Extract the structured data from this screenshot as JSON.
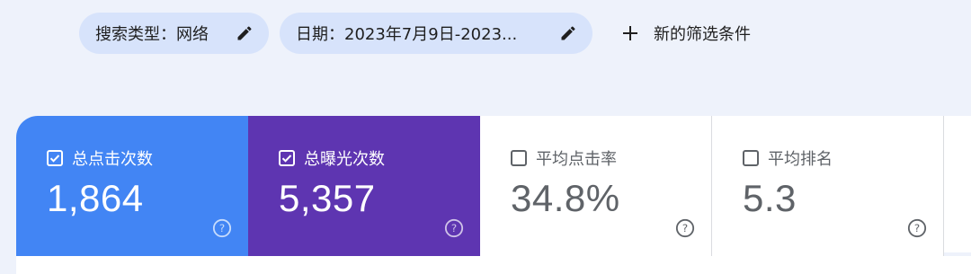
{
  "filters": {
    "search_type_chip": "搜索类型：网络",
    "date_chip": "日期：2023年7月9日-2023...",
    "new_filter_label": "新的筛选条件"
  },
  "metrics": [
    {
      "label": "总点击次数",
      "value": "1,864",
      "checked": true,
      "color": "#4285f4"
    },
    {
      "label": "总曝光次数",
      "value": "5,357",
      "checked": true,
      "color": "#5e35b1"
    },
    {
      "label": "平均点击率",
      "value": "34.8%",
      "checked": false
    },
    {
      "label": "平均排名",
      "value": "5.3",
      "checked": false
    }
  ],
  "icons": {
    "edit": "pencil-icon",
    "add": "plus-icon",
    "checked": "checkbox-checked-icon",
    "unchecked": "checkbox-unchecked-icon",
    "help": "help-circle-icon"
  }
}
